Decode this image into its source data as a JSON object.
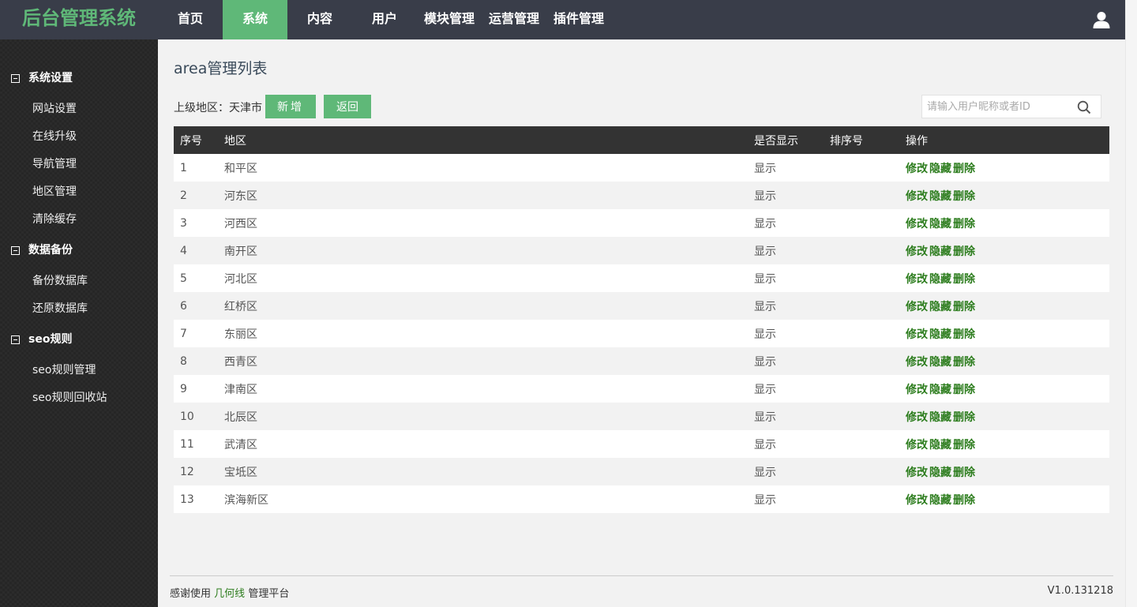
{
  "header": {
    "logo": "后台管理系统",
    "nav": [
      {
        "label": "首页"
      },
      {
        "label": "系统",
        "active": true
      },
      {
        "label": "内容"
      },
      {
        "label": "用户"
      },
      {
        "label": "模块管理"
      },
      {
        "label": "运营管理"
      },
      {
        "label": "插件管理"
      }
    ],
    "user_icon": "user-icon"
  },
  "sidebar": {
    "groups": [
      {
        "title": "系统设置",
        "items": [
          "网站设置",
          "在线升级",
          "导航管理",
          "地区管理",
          "清除缓存"
        ]
      },
      {
        "title": "数据备份",
        "items": [
          "备份数据库",
          "还原数据库"
        ]
      },
      {
        "title": "seo规则",
        "items": [
          "seo规则管理",
          "seo规则回收站"
        ]
      }
    ]
  },
  "main": {
    "title": "area管理列表",
    "parent_label": "上级地区：天津市",
    "add_button": "新增",
    "back_button": "返回",
    "search_placeholder": "请输入用户昵称或者ID",
    "table": {
      "headers": [
        "序号",
        "地区",
        "是否显示",
        "排序号",
        "操作"
      ],
      "rows": [
        {
          "id": "1",
          "area": "和平区",
          "show": "显示",
          "sort": ""
        },
        {
          "id": "2",
          "area": "河东区",
          "show": "显示",
          "sort": ""
        },
        {
          "id": "3",
          "area": "河西区",
          "show": "显示",
          "sort": ""
        },
        {
          "id": "4",
          "area": "南开区",
          "show": "显示",
          "sort": ""
        },
        {
          "id": "5",
          "area": "河北区",
          "show": "显示",
          "sort": ""
        },
        {
          "id": "6",
          "area": "红桥区",
          "show": "显示",
          "sort": ""
        },
        {
          "id": "7",
          "area": "东丽区",
          "show": "显示",
          "sort": ""
        },
        {
          "id": "8",
          "area": "西青区",
          "show": "显示",
          "sort": ""
        },
        {
          "id": "9",
          "area": "津南区",
          "show": "显示",
          "sort": ""
        },
        {
          "id": "10",
          "area": "北辰区",
          "show": "显示",
          "sort": ""
        },
        {
          "id": "11",
          "area": "武清区",
          "show": "显示",
          "sort": ""
        },
        {
          "id": "12",
          "area": "宝坻区",
          "show": "显示",
          "sort": ""
        },
        {
          "id": "13",
          "area": "滨海新区",
          "show": "显示",
          "sort": ""
        }
      ],
      "actions": [
        "修改",
        "隐藏",
        "删除"
      ]
    }
  },
  "footer": {
    "prefix": "感谢使用",
    "brand": "几何线",
    "suffix": "管理平台",
    "version": "V1.0.131218"
  },
  "colors": {
    "accent": "#5fb878",
    "header_bg": "#393d49",
    "link": "#2d7d1e"
  }
}
